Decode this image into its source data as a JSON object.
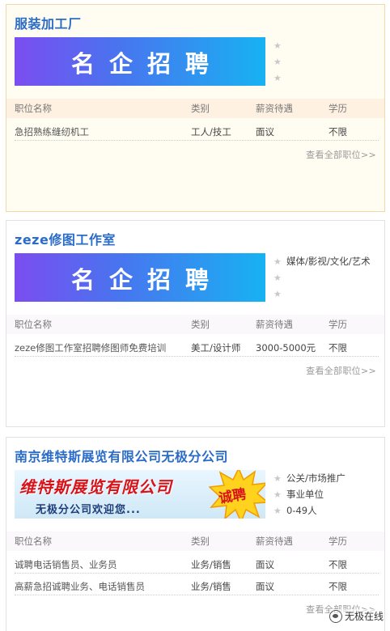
{
  "columns": {
    "title": "职位名称",
    "category": "类别",
    "salary": "薪资待遇",
    "education": "学历"
  },
  "more_label": "查看全部职位>>",
  "star_glyph": "★",
  "cards": [
    {
      "company": "服装加工厂",
      "banner_text": "名企招聘",
      "tags": [],
      "jobs": [
        {
          "title": "急招熟练缝纫机工",
          "category": "工人/技工",
          "salary": "面议",
          "education": "不限"
        }
      ]
    },
    {
      "company": "zeze修图工作室",
      "banner_text": "名企招聘",
      "tags": [
        "媒体/影视/文化/艺术"
      ],
      "jobs": [
        {
          "title": "zeze修图工作室招聘修图师免费培训",
          "category": "美工/设计师",
          "salary": "3000-5000元",
          "education": "不限"
        }
      ]
    },
    {
      "company": "南京维特斯展览有限公司无极分公司",
      "banner_title": "维特斯展览有限公司",
      "banner_sub": "无极分公司欢迎您...",
      "banner_burst": "诚聘",
      "tags": [
        "公关/市场推广",
        "事业单位",
        "0-49人"
      ],
      "jobs": [
        {
          "title": "诚聘电话销售员、业务员",
          "category": "业务/销售",
          "salary": "面议",
          "education": "不限"
        },
        {
          "title": "高薪急招诚聘业务、电话销售员",
          "category": "业务/销售",
          "salary": "面议",
          "education": "不限"
        }
      ]
    }
  ],
  "watermark": "无极在线",
  "colors": {
    "company_title": "#2a6cc7",
    "banner_start": "#7b4df0",
    "banner_end": "#17b2f2",
    "card1_bg": "#fffdf2",
    "accent_red": "#d8131a"
  },
  "icons": {
    "rating": "star-icon",
    "watermark": "wechat-icon"
  }
}
